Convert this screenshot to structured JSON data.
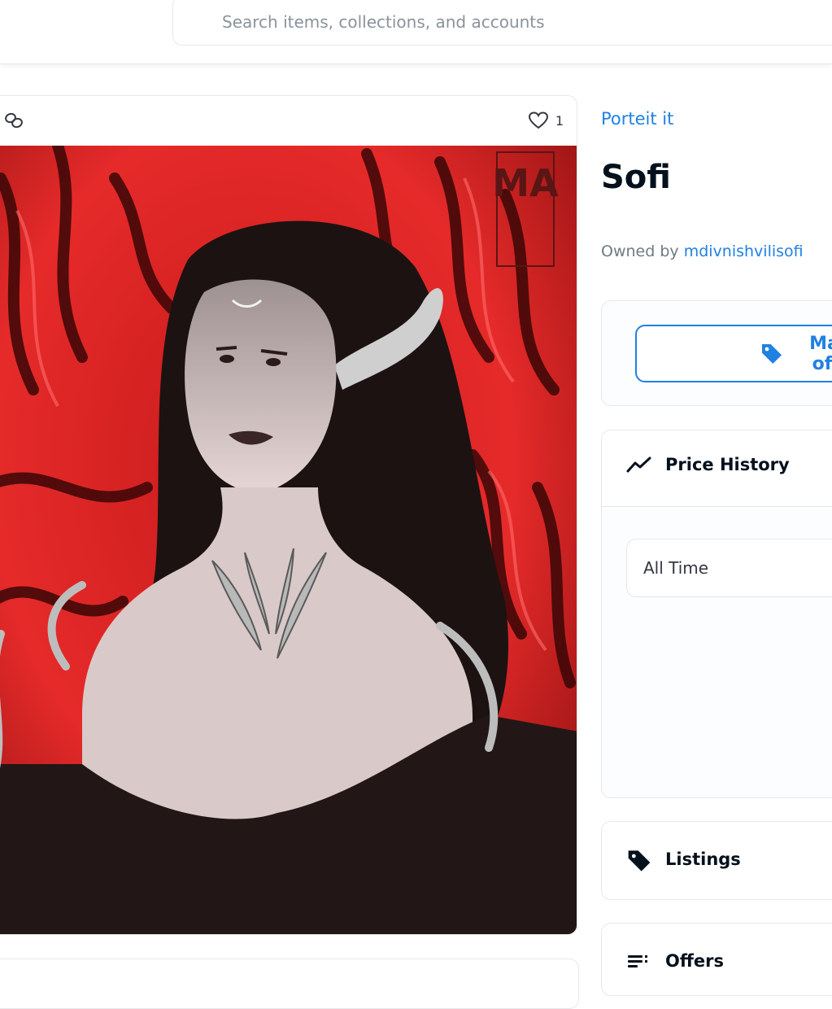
{
  "search": {
    "placeholder": "Search items, collections, and accounts"
  },
  "item_card": {
    "favorite_count": "1",
    "watermark": "MA"
  },
  "item": {
    "collection_name": "Porteit it",
    "title": "Sofi",
    "owned_by_label": "Owned by",
    "owner": "mdivnishvilisofi"
  },
  "actions": {
    "sell_label": "Make offer"
  },
  "price_history": {
    "title": "Price History",
    "time_filter": "All Time"
  },
  "listings": {
    "title": "Listings"
  },
  "offers": {
    "title": "Offers"
  },
  "colors": {
    "accent": "#2081e2",
    "text": "#04111d",
    "muted": "#707a83",
    "border": "#e5e8eb"
  }
}
